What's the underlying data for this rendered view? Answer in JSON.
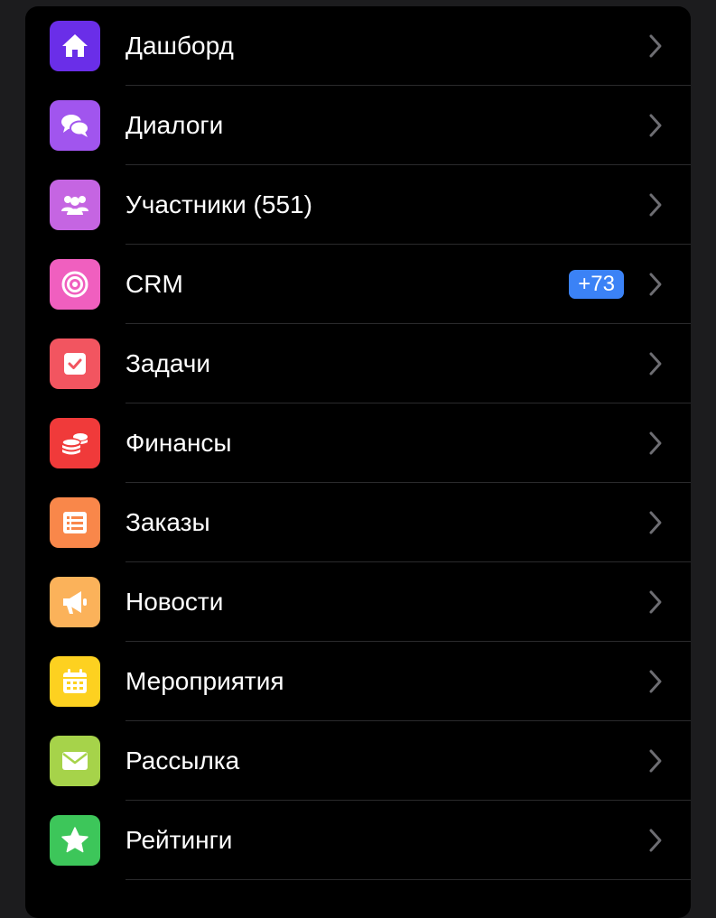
{
  "colors": {
    "background": "#1c1c1e",
    "panel": "#000000",
    "separator": "#2a2a2c",
    "text": "#ffffff",
    "chevron": "#6d6d72",
    "badge": "#3b82f6"
  },
  "menu": {
    "items": [
      {
        "label": "Дашборд",
        "icon": "home-icon",
        "color": "#6a2ee8"
      },
      {
        "label": "Диалоги",
        "icon": "chat-bubbles-icon",
        "color": "#a155ee"
      },
      {
        "label": "Участники (551)",
        "icon": "users-icon",
        "color": "#c565e2"
      },
      {
        "label": "CRM",
        "icon": "target-icon",
        "color": "#f05fbf",
        "badge": "+73"
      },
      {
        "label": "Задачи",
        "icon": "checkbox-icon",
        "color": "#f25560"
      },
      {
        "label": "Финансы",
        "icon": "coins-icon",
        "color": "#f03a3a"
      },
      {
        "label": "Заказы",
        "icon": "list-icon",
        "color": "#f9874a"
      },
      {
        "label": "Новости",
        "icon": "megaphone-icon",
        "color": "#fbb25a"
      },
      {
        "label": "Мероприятия",
        "icon": "calendar-icon",
        "color": "#fdd120"
      },
      {
        "label": "Рассылка",
        "icon": "envelope-icon",
        "color": "#a6d34a"
      },
      {
        "label": "Рейтинги",
        "icon": "star-icon",
        "color": "#3dc65a"
      }
    ]
  }
}
